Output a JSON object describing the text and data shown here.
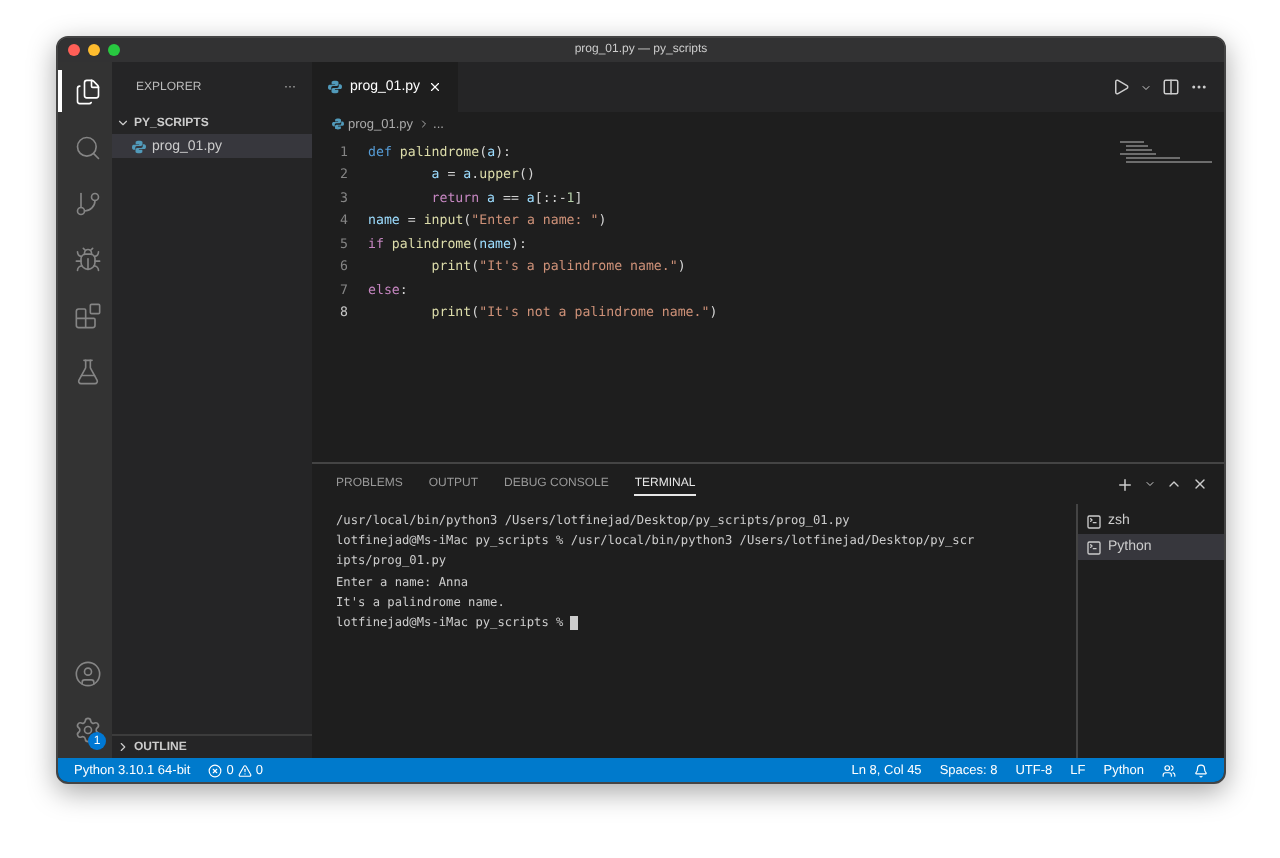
{
  "window": {
    "title": "prog_01.py — py_scripts"
  },
  "activity_bar": {
    "items": [
      {
        "kind": "files",
        "selected": true
      },
      {
        "kind": "search",
        "selected": false
      },
      {
        "kind": "source-control",
        "selected": false
      },
      {
        "kind": "run",
        "selected": false
      },
      {
        "kind": "extensions",
        "selected": false
      },
      {
        "kind": "testing",
        "selected": false
      }
    ],
    "bottom": [
      {
        "kind": "account"
      },
      {
        "kind": "settings",
        "badge": "1"
      }
    ]
  },
  "sidebar": {
    "title": "EXPLORER",
    "more": "···",
    "folder": {
      "name": "PY_SCRIPTS",
      "expanded": true,
      "files": [
        {
          "name": "prog_01.py",
          "selected": true
        }
      ]
    },
    "outline": {
      "name": "OUTLINE",
      "expanded": false
    }
  },
  "editor": {
    "tabs": [
      {
        "label": "prog_01.py",
        "selected": true
      }
    ],
    "breadcrumb": [
      "prog_01.py",
      "..."
    ],
    "lines": [
      {
        "number": "1",
        "active": false,
        "tokens": [
          {
            "t": "def ",
            "kind": "storage"
          },
          {
            "t": "palindrome",
            "kind": "function"
          },
          {
            "t": "(",
            "kind": "plain"
          },
          {
            "t": "a",
            "kind": "variable"
          },
          {
            "t": "):",
            "kind": "plain"
          }
        ]
      },
      {
        "number": "2",
        "active": false,
        "tokens": [
          {
            "t": "        a",
            "kind": "variable"
          },
          {
            "t": " = ",
            "kind": "plain"
          },
          {
            "t": "a",
            "kind": "variable"
          },
          {
            "t": ".",
            "kind": "plain"
          },
          {
            "t": "upper",
            "kind": "function"
          },
          {
            "t": "()",
            "kind": "plain"
          }
        ]
      },
      {
        "number": "3",
        "active": false,
        "tokens": [
          {
            "t": "        return ",
            "kind": "control"
          },
          {
            "t": "a",
            "kind": "variable"
          },
          {
            "t": " == ",
            "kind": "plain"
          },
          {
            "t": "a",
            "kind": "variable"
          },
          {
            "t": "[::-",
            "kind": "plain"
          },
          {
            "t": "1",
            "kind": "number"
          },
          {
            "t": "]",
            "kind": "plain"
          }
        ]
      },
      {
        "number": "4",
        "active": false,
        "tokens": [
          {
            "t": "name",
            "kind": "variable"
          },
          {
            "t": " = ",
            "kind": "plain"
          },
          {
            "t": "input",
            "kind": "function"
          },
          {
            "t": "(",
            "kind": "plain"
          },
          {
            "t": "\"Enter a name: \"",
            "kind": "string"
          },
          {
            "t": ")",
            "kind": "plain"
          }
        ]
      },
      {
        "number": "5",
        "active": false,
        "tokens": [
          {
            "t": "if ",
            "kind": "control"
          },
          {
            "t": "palindrome",
            "kind": "function"
          },
          {
            "t": "(",
            "kind": "plain"
          },
          {
            "t": "name",
            "kind": "variable"
          },
          {
            "t": "):",
            "kind": "plain"
          }
        ]
      },
      {
        "number": "6",
        "active": false,
        "tokens": [
          {
            "t": "        print",
            "kind": "function"
          },
          {
            "t": "(",
            "kind": "plain"
          },
          {
            "t": "\"It's a palindrome name.\"",
            "kind": "string"
          },
          {
            "t": ")",
            "kind": "plain"
          }
        ]
      },
      {
        "number": "7",
        "active": false,
        "tokens": [
          {
            "t": "else",
            "kind": "control"
          },
          {
            "t": ":",
            "kind": "plain"
          }
        ]
      },
      {
        "number": "8",
        "active": true,
        "tokens": [
          {
            "t": "        print",
            "kind": "function"
          },
          {
            "t": "(",
            "kind": "plain"
          },
          {
            "t": "\"It's not a palindrome name.\"",
            "kind": "string"
          },
          {
            "t": ")",
            "kind": "plain"
          }
        ]
      }
    ]
  },
  "panel": {
    "tabs": [
      {
        "label": "PROBLEMS",
        "selected": false
      },
      {
        "label": "OUTPUT",
        "selected": false
      },
      {
        "label": "DEBUG CONSOLE",
        "selected": false
      },
      {
        "label": "TERMINAL",
        "selected": true
      }
    ],
    "terminal_lines": [
      "/usr/local/bin/python3 /Users/lotfinejad/Desktop/py_scripts/prog_01.py",
      "lotfinejad@Ms-iMac py_scripts % /usr/local/bin/python3 /Users/lotfinejad/Desktop/py_scr",
      "ipts/prog_01.py",
      "Enter a name: Anna",
      "It's a palindrome name.",
      "lotfinejad@Ms-iMac py_scripts % "
    ],
    "terminals": [
      {
        "name": "zsh",
        "selected": false
      },
      {
        "name": "Python",
        "selected": true
      }
    ]
  },
  "status_bar": {
    "interpreter": "Python 3.10.1 64-bit",
    "errors": "0",
    "warnings": "0",
    "right": [
      "Ln 8, Col 45",
      "Spaces: 8",
      "UTF-8",
      "LF",
      "Python"
    ]
  }
}
